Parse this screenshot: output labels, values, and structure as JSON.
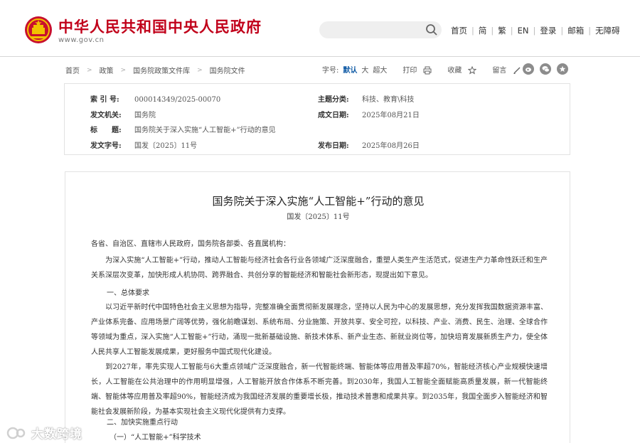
{
  "header": {
    "site_title": "中华人民共和国中央人民政府",
    "site_url": "www.gov.cn",
    "search_placeholder": "",
    "nav": [
      "首页",
      "简",
      "繁",
      "EN",
      "登录",
      "邮箱",
      "无障碍"
    ]
  },
  "breadcrumb": [
    "首页",
    "政策",
    "国务院政策文件库",
    "国务院文件"
  ],
  "tools": {
    "font_size_label": "字号:",
    "font_default": "默认",
    "font_large": "大",
    "font_xlarge": "超大",
    "print": "打印",
    "favorite": "收藏",
    "comment": "留言"
  },
  "info": {
    "index_no_label": "索 引 号:",
    "index_no": "000014349/2025-00070",
    "category_label": "主题分类:",
    "category": "科技、教育\\科技",
    "issuer_label": "发文机关:",
    "issuer": "国务院",
    "date_written_label": "成文日期:",
    "date_written": "2025年08月21日",
    "title_label": "标　　题:",
    "title": "国务院关于深入实施“人工智能+”行动的意见",
    "doc_no_label": "发文字号:",
    "doc_no": "国发〔2025〕11号",
    "publish_label": "发布日期:",
    "publish_date": "2025年08月26日"
  },
  "article": {
    "title": "国务院关于深入实施“人工智能+”行动的意见",
    "doc_no": "国发〔2025〕11号",
    "salutation": "各省、自治区、直辖市人民政府，国务院各部委、各直属机构：",
    "para1": "　　为深入实施“人工智能+”行动，推动人工智能与经济社会各行业各领域广泛深度融合，重塑人类生产生活范式，促进生产力革命性跃迁和生产关系深层次变革，加快形成人机协同、跨界融合、共创分享的智能经济和智能社会新形态，现提出如下意见。",
    "heading1": "一、总体要求",
    "para2": "　　以习近平新时代中国特色社会主义思想为指导，完整准确全面贯彻新发展理念，坚持以人民为中心的发展思想，充分发挥我国数据资源丰富、产业体系完备、应用场景广阔等优势，强化前瞻谋划、系统布局、分业施策、开放共享、安全可控，以科技、产业、消费、民生、治理、全球合作等领域为重点，深入实施“人工智能+”行动，涌现一批新基础设施、新技术体系、新产业生态、新就业岗位等，加快培育发展新质生产力，使全体人民共享人工智能发展成果，更好服务中国式现代化建设。",
    "para3": "　　到2027年，率先实现人工智能与6大重点领域广泛深度融合，新一代智能终端、智能体等应用普及率超70%，智能经济核心产业规模快速增长，人工智能在公共治理中的作用明显增强，人工智能开放合作体系不断完善。到2030年，我国人工智能全面赋能高质量发展，新一代智能终端、智能体等应用普及率超90%，智能经济成为我国经济发展的重要增长极，推动技术普惠和成果共享。到2035年，我国全面步入智能经济和智能社会发展新阶段，为基本实现社会主义现代化提供有力支撑。",
    "heading2": "二、加快实施重点行动",
    "subheading1": "（一）“人工智能+”科学技术"
  },
  "watermark": "大数跨境",
  "colors": {
    "brand_red": "#c1001a",
    "accent_blue": "#0f5aa5"
  }
}
